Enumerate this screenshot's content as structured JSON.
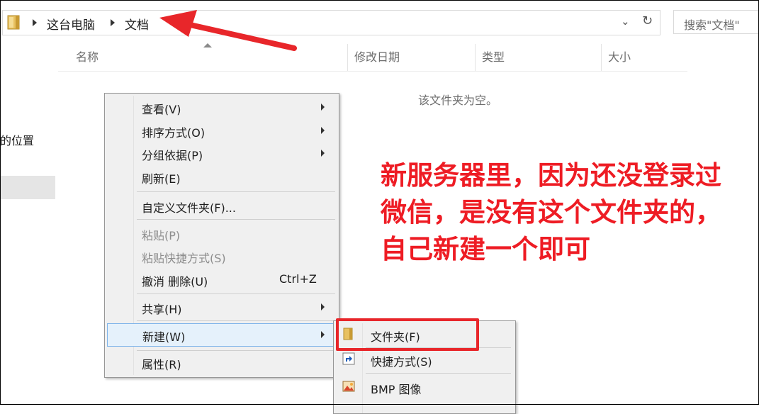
{
  "address_bar": {
    "crumbs": [
      "这台电脑",
      "文档"
    ],
    "dropdown_glyph": "⌄",
    "refresh_glyph": "↻"
  },
  "search": {
    "placeholder": "搜索\"文档\""
  },
  "left_pane": {
    "location_fragment": "的位置"
  },
  "columns": [
    "名称",
    "修改日期",
    "类型",
    "大小"
  ],
  "empty_message": "该文件夹为空。",
  "context_menu": {
    "items": [
      {
        "label": "查看(V)",
        "submenu": true
      },
      {
        "label": "排序方式(O)",
        "submenu": true
      },
      {
        "label": "分组依据(P)",
        "submenu": true
      },
      {
        "label": "刷新(E)"
      },
      {
        "label": "自定义文件夹(F)..."
      },
      {
        "label": "粘贴(P)",
        "disabled": true
      },
      {
        "label": "粘贴快捷方式(S)",
        "disabled": true
      },
      {
        "label": "撤消 删除(U)",
        "shortcut": "Ctrl+Z"
      },
      {
        "label": "共享(H)",
        "submenu": true
      },
      {
        "label": "新建(W)",
        "submenu": true,
        "highlighted": true
      },
      {
        "label": "属性(R)"
      }
    ]
  },
  "new_submenu": {
    "items": [
      {
        "label": "文件夹(F)",
        "icon": "folder-icon"
      },
      {
        "label": "快捷方式(S)",
        "icon": "shortcut-icon"
      },
      {
        "label": "BMP 图像",
        "icon": "bmp-image-icon"
      }
    ]
  },
  "annotation": {
    "lines": [
      "新服务器里，因为还没登录过",
      "微信，是没有这个文件夹的，",
      "自己新建一个即可"
    ],
    "color": "#ee1c24"
  }
}
